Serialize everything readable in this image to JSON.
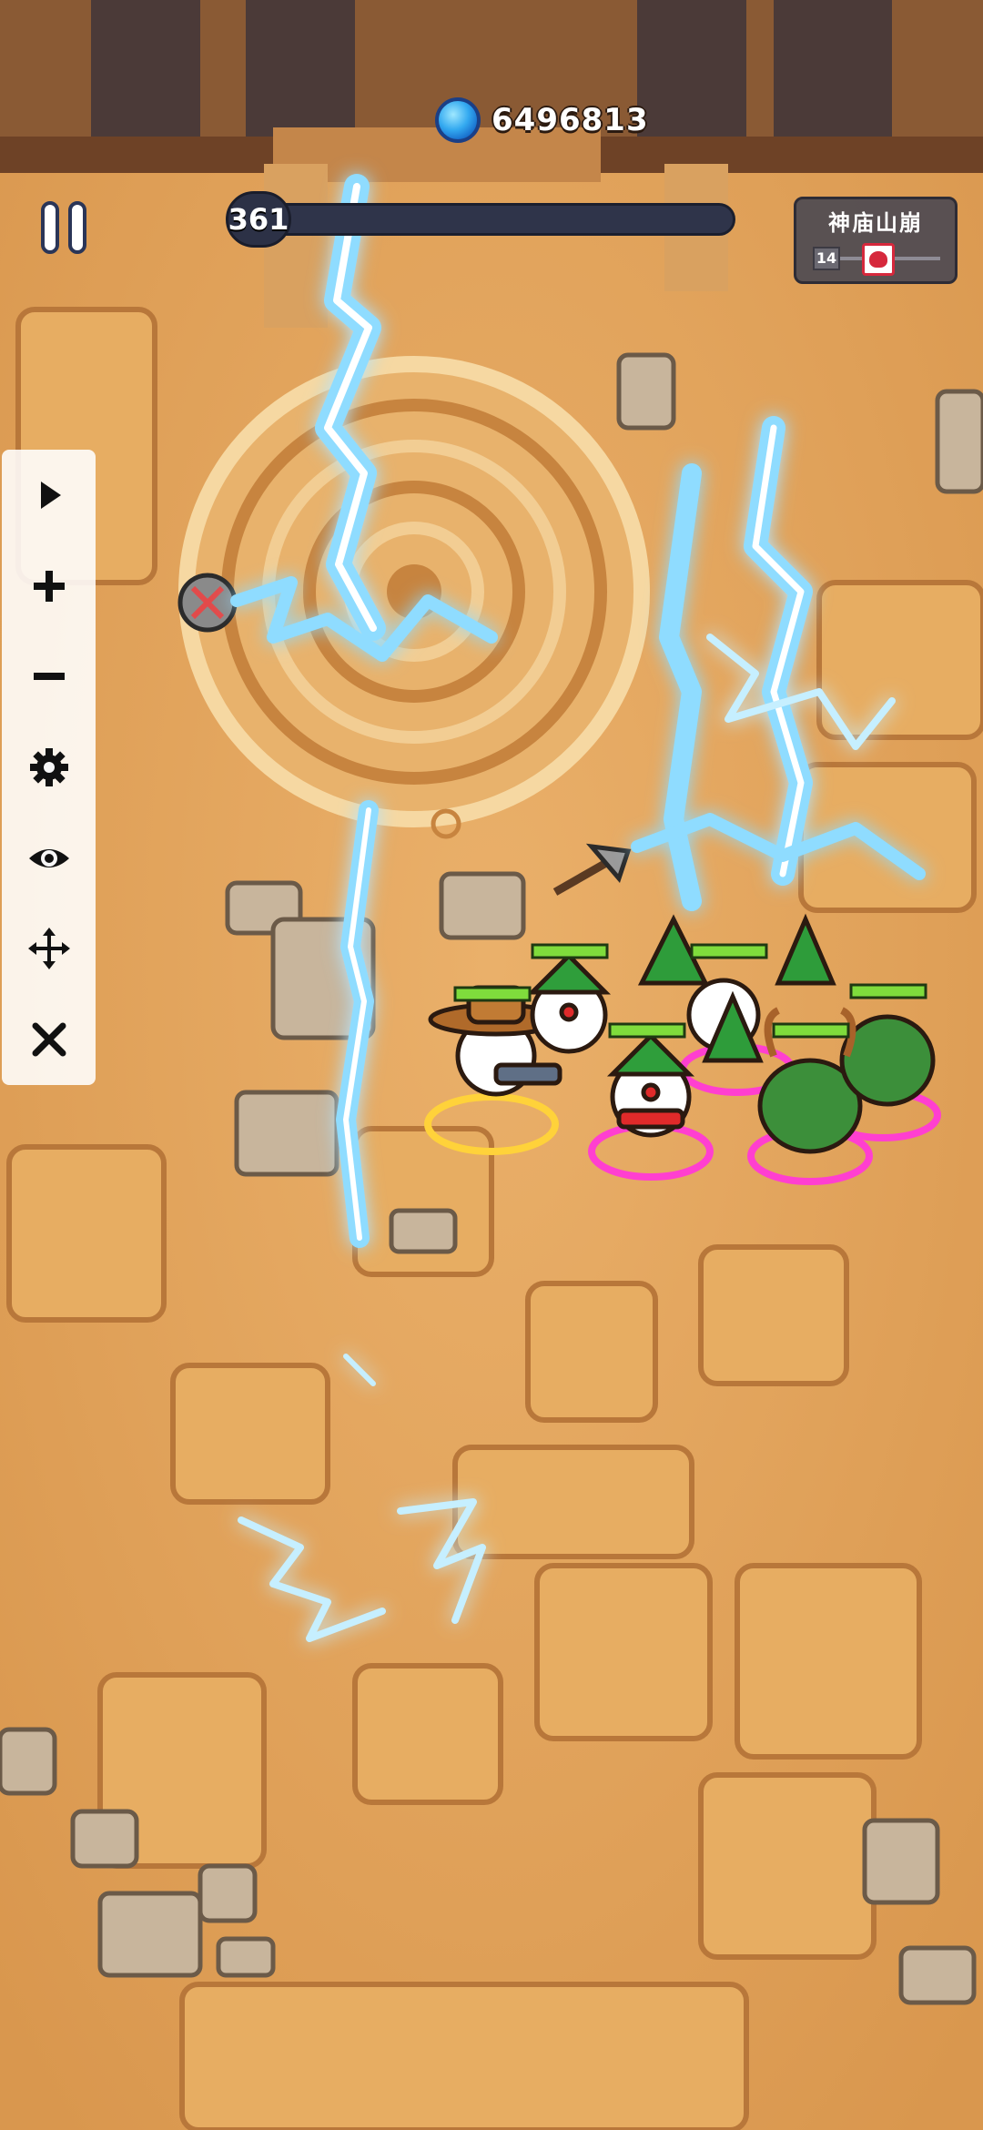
{
  "hud": {
    "currency": {
      "icon": "blue-gem-icon",
      "value": "6496813"
    },
    "wave": {
      "number": "361",
      "progress": 0.0
    },
    "pause_icon": "pause-icon",
    "stage": {
      "title": "神庙山崩",
      "level": "14",
      "boss_icon": "boss-skull-icon"
    }
  },
  "tool_panel": {
    "buttons": [
      {
        "icon": "play-icon"
      },
      {
        "icon": "plus-icon"
      },
      {
        "icon": "minus-icon"
      },
      {
        "icon": "gear-icon"
      },
      {
        "icon": "eye-icon"
      },
      {
        "icon": "move-icon"
      },
      {
        "icon": "close-icon"
      }
    ]
  },
  "scene": {
    "terrain": "sandstone temple floor",
    "effects": [
      "lightning-strikes"
    ],
    "units": [
      "cowboy-gunner",
      "santa-snowmen",
      "christmas-trees",
      "reindeer-bushes"
    ]
  },
  "colors": {
    "floor": "#e0a35a",
    "tile": "#e7ad62",
    "tile_edge": "#b8773a",
    "lightning": "#8fdcff",
    "health": "#7fdc3c",
    "aura_pink": "#ff3fd0",
    "aura_yellow": "#ffd23a"
  }
}
